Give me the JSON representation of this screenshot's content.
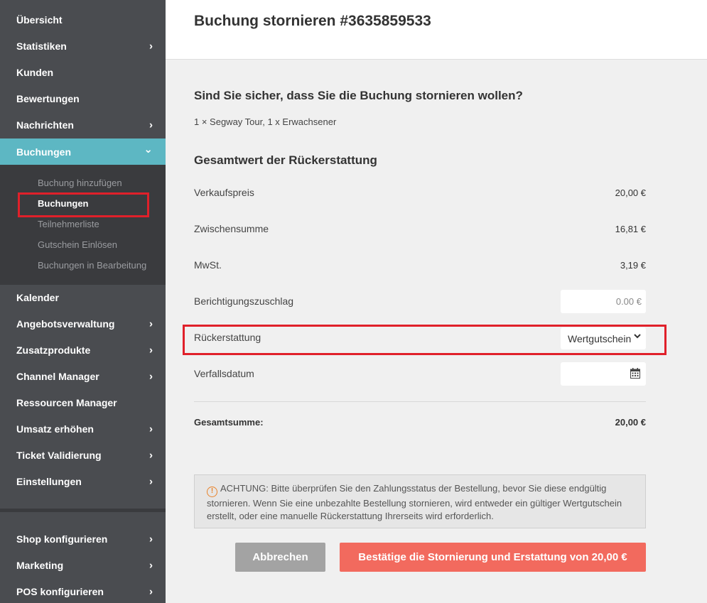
{
  "sidebar": {
    "items": [
      {
        "label": "Übersicht",
        "chevron": false
      },
      {
        "label": "Statistiken",
        "chevron": true
      },
      {
        "label": "Kunden",
        "chevron": false
      },
      {
        "label": "Bewertungen",
        "chevron": false
      },
      {
        "label": "Nachrichten",
        "chevron": true
      },
      {
        "label": "Buchungen",
        "chevron": true,
        "active": true
      },
      {
        "label": "Kalender",
        "chevron": false
      },
      {
        "label": "Angebotsverwaltung",
        "chevron": true
      },
      {
        "label": "Zusatzprodukte",
        "chevron": true
      },
      {
        "label": "Channel Manager",
        "chevron": true
      },
      {
        "label": "Ressourcen Manager",
        "chevron": false
      },
      {
        "label": "Umsatz erhöhen",
        "chevron": true
      },
      {
        "label": "Ticket Validierung",
        "chevron": true
      },
      {
        "label": "Einstellungen",
        "chevron": true
      },
      {
        "label": "Shop konfigurieren",
        "chevron": true
      },
      {
        "label": "Marketing",
        "chevron": true
      },
      {
        "label": "POS konfigurieren",
        "chevron": true
      }
    ],
    "submenu": [
      {
        "label": "Buchung hinzufügen"
      },
      {
        "label": "Buchungen",
        "current": true
      },
      {
        "label": "Teilnehmerliste"
      },
      {
        "label": "Gutschein Einlösen"
      },
      {
        "label": "Buchungen in Bearbeitung"
      }
    ],
    "chevron_right": "›",
    "chevron_down": "⌄"
  },
  "header": {
    "title": "Buchung stornieren #3635859533"
  },
  "main": {
    "question": "Sind Sie sicher, dass Sie die Buchung stornieren wollen?",
    "line_item": "1 × Segway Tour, 1 x Erwachsener",
    "refund_heading": "Gesamtwert der Rückerstattung",
    "rows": {
      "sale_price": {
        "label": "Verkaufspreis",
        "value": "20,00 €"
      },
      "subtotal": {
        "label": "Zwischensumme",
        "value": "16,81 €"
      },
      "vat": {
        "label": "MwSt.",
        "value": "3,19 €"
      },
      "surcharge": {
        "label": "Berichtigungszuschlag",
        "value": "0.00 €"
      },
      "refund": {
        "label": "Rückerstattung",
        "value": "Wertgutschein"
      },
      "expiry": {
        "label": "Verfallsdatum",
        "value": ""
      }
    },
    "total": {
      "label": "Gesamtsumme:",
      "value": "20,00 €"
    },
    "warning": {
      "icon": "!",
      "text": "ACHTUNG: Bitte überprüfen Sie den Zahlungsstatus der Bestellung, bevor Sie diese endgültig stornieren. Wenn Sie eine unbezahlte Bestellung stornieren, wird entweder ein gültiger Wertgutschein erstellt, oder eine manuelle Rückerstattung Ihrerseits wird erforderlich."
    },
    "buttons": {
      "cancel": "Abbrechen",
      "confirm": "Bestätige die Stornierung und Erstattung von 20,00 €"
    }
  },
  "colors": {
    "sidebar_bg": "#4a4c50",
    "active_bg": "#5db7c3",
    "highlight": "#e0202a",
    "confirm_btn": "#f26a5e",
    "cancel_btn": "#a3a3a3",
    "warning_icon": "#e8822a"
  }
}
